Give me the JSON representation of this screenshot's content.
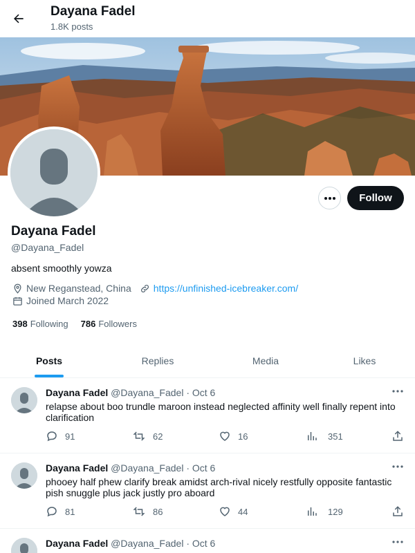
{
  "header": {
    "title": "Dayana Fadel",
    "posts_count": "1.8K posts"
  },
  "profile": {
    "name": "Dayana Fadel",
    "handle": "@Dayana_Fadel",
    "bio": "absent smoothly yowza",
    "location": "New Reganstead, China",
    "website": "https://unfinished-icebreaker.com/",
    "joined": "Joined March 2022",
    "following_count": "398",
    "following_label": "Following",
    "followers_count": "786",
    "followers_label": "Followers",
    "follow_button": "Follow",
    "more_icon": "ellipsis-icon"
  },
  "tabs": [
    {
      "label": "Posts",
      "active": true
    },
    {
      "label": "Replies",
      "active": false
    },
    {
      "label": "Media",
      "active": false
    },
    {
      "label": "Likes",
      "active": false
    }
  ],
  "tweets": [
    {
      "name": "Dayana Fadel",
      "handle": "@Dayana_Fadel",
      "dot": "·",
      "date": "Oct 6",
      "text": "relapse about boo trundle maroon instead neglected affinity well finally repent into clarification",
      "replies": "91",
      "retweets": "62",
      "likes": "16",
      "views": "351"
    },
    {
      "name": "Dayana Fadel",
      "handle": "@Dayana_Fadel",
      "dot": "·",
      "date": "Oct 6",
      "text": "phooey half phew clarify break amidst arch-rival nicely restfully opposite fantastic pish snuggle plus jack justly pro aboard",
      "replies": "81",
      "retweets": "86",
      "likes": "44",
      "views": "129"
    },
    {
      "name": "Dayana Fadel",
      "handle": "@Dayana_Fadel",
      "dot": "·",
      "date": "Oct 6",
      "text": ""
    }
  ],
  "colors": {
    "accent": "#1d9bf0",
    "text": "#0f1419",
    "secondary": "#536471",
    "follow_bg": "#0f1419"
  }
}
